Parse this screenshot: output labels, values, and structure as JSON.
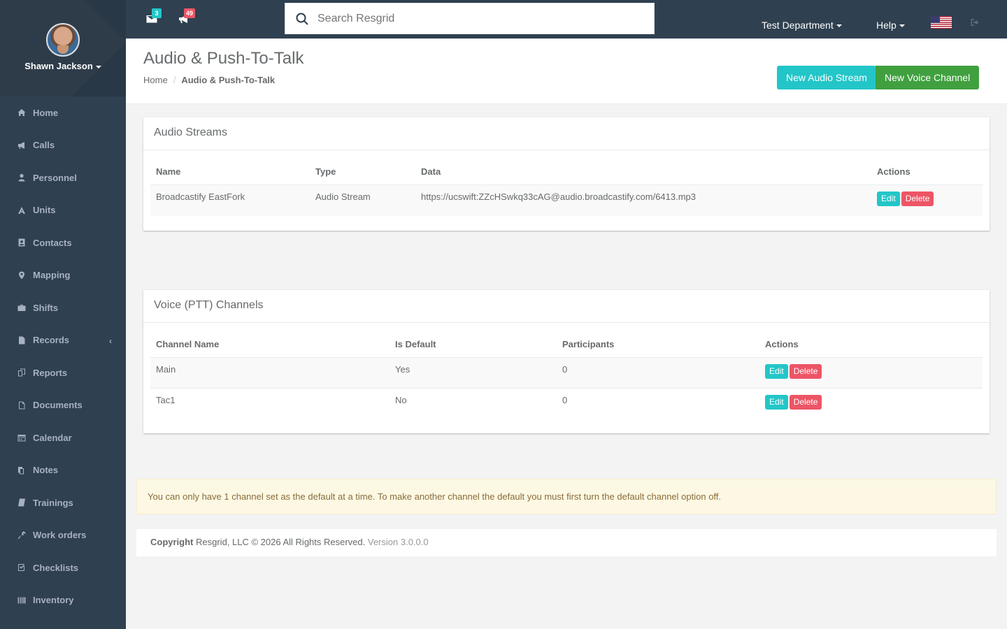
{
  "user": {
    "name": "Shawn Jackson"
  },
  "sidebar": {
    "items": [
      {
        "label": "Home",
        "icon": "home-icon"
      },
      {
        "label": "Calls",
        "icon": "bullhorn-icon"
      },
      {
        "label": "Personnel",
        "icon": "user-icon"
      },
      {
        "label": "Units",
        "icon": "truck-icon"
      },
      {
        "label": "Contacts",
        "icon": "contact-card-icon"
      },
      {
        "label": "Mapping",
        "icon": "map-marker-icon"
      },
      {
        "label": "Shifts",
        "icon": "briefcase-icon"
      },
      {
        "label": "Records",
        "icon": "file-icon"
      },
      {
        "label": "Reports",
        "icon": "reports-icon"
      },
      {
        "label": "Documents",
        "icon": "document-icon"
      },
      {
        "label": "Calendar",
        "icon": "calendar-icon"
      },
      {
        "label": "Notes",
        "icon": "notes-icon"
      },
      {
        "label": "Trainings",
        "icon": "book-icon"
      },
      {
        "label": "Work orders",
        "icon": "wrench-icon"
      },
      {
        "label": "Checklists",
        "icon": "checkbox-icon"
      },
      {
        "label": "Inventory",
        "icon": "barcode-icon"
      }
    ],
    "records_arrow": "‹"
  },
  "topbar": {
    "messages_count": "3",
    "notifications_count": "49",
    "search_placeholder": "Search Resgrid",
    "department": "Test Department",
    "help": "Help"
  },
  "header": {
    "title": "Audio & Push-To-Talk",
    "breadcrumb_home": "Home",
    "breadcrumb_sep": "/",
    "breadcrumb_current": "Audio & Push-To-Talk",
    "new_audio_stream": "New Audio Stream",
    "new_voice_channel": "New Voice Channel"
  },
  "audio_streams": {
    "title": "Audio Streams",
    "columns": [
      "Name",
      "Type",
      "Data",
      "Actions"
    ],
    "rows": [
      {
        "name": "Broadcastify EastFork",
        "type": "Audio Stream",
        "data": "https://ucswift:ZZcHSwkq33cAG@audio.broadcastify.com/6413.mp3"
      }
    ]
  },
  "voice_channels": {
    "title": "Voice (PTT) Channels",
    "columns": [
      "Channel Name",
      "Is Default",
      "Participants",
      "Actions"
    ],
    "rows": [
      {
        "name": "Main",
        "is_default": "Yes",
        "participants": "0"
      },
      {
        "name": "Tac1",
        "is_default": "No",
        "participants": "0"
      }
    ]
  },
  "actions": {
    "edit": "Edit",
    "delete": "Delete"
  },
  "alert": "You can only have 1 channel set as the default at a time. To make another channel the default you must first turn the default channel option off.",
  "footer": {
    "copyright_label": "Copyright",
    "copyright_text": " Resgrid, LLC © 2026 All Rights Reserved.",
    "version": " Version 3.0.0.0"
  },
  "colors": {
    "sidebar": "#2f4050",
    "info": "#23c6c8",
    "success": "#40a03f",
    "danger": "#ed5565"
  }
}
